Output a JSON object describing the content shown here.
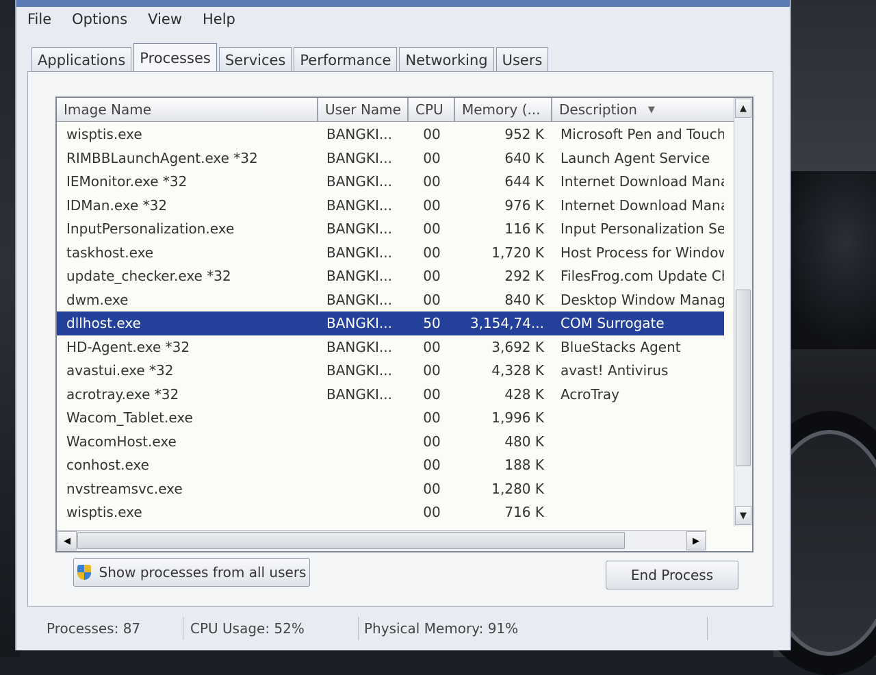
{
  "menu": {
    "file": "File",
    "options": "Options",
    "view": "View",
    "help": "Help"
  },
  "tabs": [
    "Applications",
    "Processes",
    "Services",
    "Performance",
    "Networking",
    "Users"
  ],
  "active_tab": "Processes",
  "columns": {
    "image_name": "Image Name",
    "user_name": "User Name",
    "cpu": "CPU",
    "memory": "Memory (...",
    "description": "Description"
  },
  "processes": [
    {
      "name": "wisptis.exe",
      "user": "BANGKI...",
      "cpu": "00",
      "memory": "952 K",
      "description": "Microsoft Pen and Touch"
    },
    {
      "name": "RIMBBLaunchAgent.exe *32",
      "user": "BANGKI...",
      "cpu": "00",
      "memory": "640 K",
      "description": "Launch Agent Service"
    },
    {
      "name": "IEMonitor.exe *32",
      "user": "BANGKI...",
      "cpu": "00",
      "memory": "644 K",
      "description": "Internet Download Mana"
    },
    {
      "name": "IDMan.exe *32",
      "user": "BANGKI...",
      "cpu": "00",
      "memory": "976 K",
      "description": "Internet Download Mana"
    },
    {
      "name": "InputPersonalization.exe",
      "user": "BANGKI...",
      "cpu": "00",
      "memory": "116 K",
      "description": "Input Personalization Se"
    },
    {
      "name": "taskhost.exe",
      "user": "BANGKI...",
      "cpu": "00",
      "memory": "1,720 K",
      "description": "Host Process for Window"
    },
    {
      "name": "update_checker.exe *32",
      "user": "BANGKI...",
      "cpu": "00",
      "memory": "292 K",
      "description": "FilesFrog.com Update Ch"
    },
    {
      "name": "dwm.exe",
      "user": "BANGKI...",
      "cpu": "00",
      "memory": "840 K",
      "description": "Desktop Window Manage"
    },
    {
      "name": "dllhost.exe",
      "user": "BANGKI...",
      "cpu": "50",
      "memory": "3,154,74...",
      "description": "COM Surrogate"
    },
    {
      "name": "HD-Agent.exe *32",
      "user": "BANGKI...",
      "cpu": "00",
      "memory": "3,692 K",
      "description": "BlueStacks Agent"
    },
    {
      "name": "avastui.exe *32",
      "user": "BANGKI...",
      "cpu": "00",
      "memory": "4,328 K",
      "description": "avast! Antivirus"
    },
    {
      "name": "acrotray.exe *32",
      "user": "BANGKI...",
      "cpu": "00",
      "memory": "428 K",
      "description": "AcroTray"
    },
    {
      "name": "Wacom_Tablet.exe",
      "user": "",
      "cpu": "00",
      "memory": "1,996 K",
      "description": ""
    },
    {
      "name": "WacomHost.exe",
      "user": "",
      "cpu": "00",
      "memory": "480 K",
      "description": ""
    },
    {
      "name": "conhost.exe",
      "user": "",
      "cpu": "00",
      "memory": "188 K",
      "description": ""
    },
    {
      "name": "nvstreamsvc.exe",
      "user": "",
      "cpu": "00",
      "memory": "1,280 K",
      "description": ""
    },
    {
      "name": "wisptis.exe",
      "user": "",
      "cpu": "00",
      "memory": "716 K",
      "description": ""
    }
  ],
  "selected_process": "dllhost.exe",
  "buttons": {
    "show_all": "Show processes from all users",
    "end_process": "End Process"
  },
  "status": {
    "processes": "Processes: 87",
    "cpu": "CPU Usage: 52%",
    "memory": "Physical Memory: 91%"
  },
  "icons": {
    "sort": "sort-down-icon",
    "uac": "uac-shield-icon"
  },
  "colors": {
    "selection": "#23409a",
    "window_bg": "#e8ecf2"
  }
}
